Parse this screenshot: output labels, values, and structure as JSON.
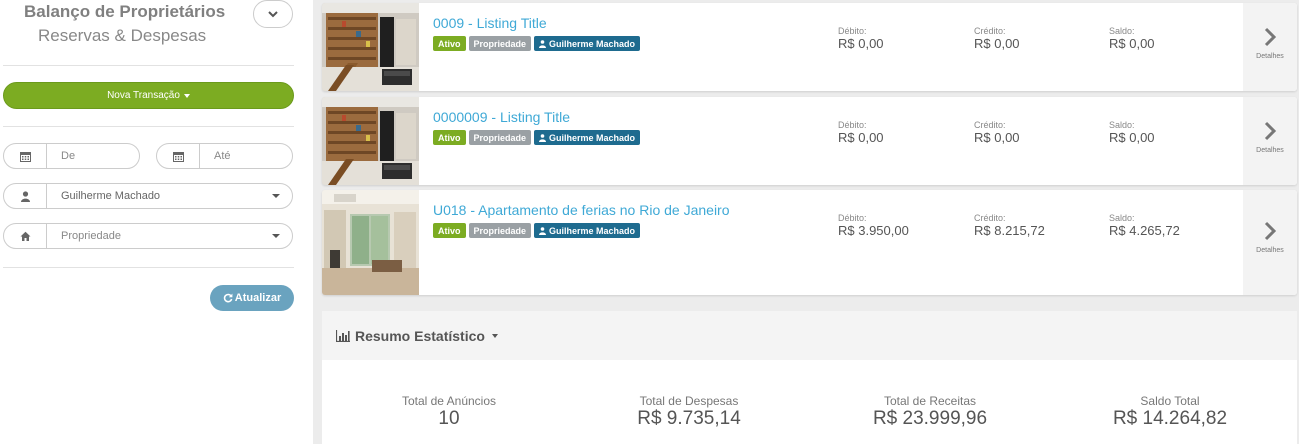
{
  "sidebar": {
    "title": "Balanço de Proprietários",
    "subtitle": "Reservas & Despesas",
    "new_transaction_label": "Nova Transação",
    "date_from_placeholder": "De",
    "date_to_placeholder": "Até",
    "owner_value": "Guilherme Machado",
    "property_placeholder": "Propriedade",
    "refresh_label": "Atualizar"
  },
  "listings": [
    {
      "title": "0009 - Listing Title",
      "badges": {
        "status": "Ativo",
        "type": "Propriedade",
        "owner": "Guilherme Machado"
      },
      "debit_label": "Débito:",
      "debit": "R$ 0,00",
      "credit_label": "Crédito:",
      "credit": "R$ 0,00",
      "balance_label": "Saldo:",
      "balance": "R$ 0,00",
      "details_label": "Detalhes"
    },
    {
      "title": "0000009 - Listing Title",
      "badges": {
        "status": "Ativo",
        "type": "Propriedade",
        "owner": "Guilherme Machado"
      },
      "debit_label": "Débito:",
      "debit": "R$ 0,00",
      "credit_label": "Crédito:",
      "credit": "R$ 0,00",
      "balance_label": "Saldo:",
      "balance": "R$ 0,00",
      "details_label": "Detalhes"
    },
    {
      "title": "U018 - Apartamento de ferias no Rio de Janeiro",
      "badges": {
        "status": "Ativo",
        "type": "Propriedade",
        "owner": "Guilherme Machado"
      },
      "debit_label": "Débito:",
      "debit": "R$ 3.950,00",
      "credit_label": "Crédito:",
      "credit": "R$ 8.215,72",
      "balance_label": "Saldo:",
      "balance": "R$ 4.265,72",
      "details_label": "Detalhes"
    }
  ],
  "stats": {
    "title": "Resumo Estatístico",
    "items": [
      {
        "label": "Total de Anúncios",
        "value": "10"
      },
      {
        "label": "Total de Despesas",
        "value": "R$ 9.735,14"
      },
      {
        "label": "Total de Receitas",
        "value": "R$ 23.999,96"
      },
      {
        "label": "Saldo Total",
        "value": "R$ 14.264,82"
      }
    ]
  },
  "icons": {
    "collapse": "chevron-down-icon",
    "calendar": "calendar-icon",
    "user": "user-icon",
    "home": "home-icon",
    "refresh": "refresh-icon",
    "details": "chevron-right-icon",
    "stats": "bar-chart-icon"
  },
  "colors": {
    "primary_green": "#7cac22",
    "link_blue": "#3fa9d6",
    "owner_badge": "#1e6b8f",
    "property_badge": "#9aa0a4",
    "refresh_button": "#6aa3bf"
  }
}
